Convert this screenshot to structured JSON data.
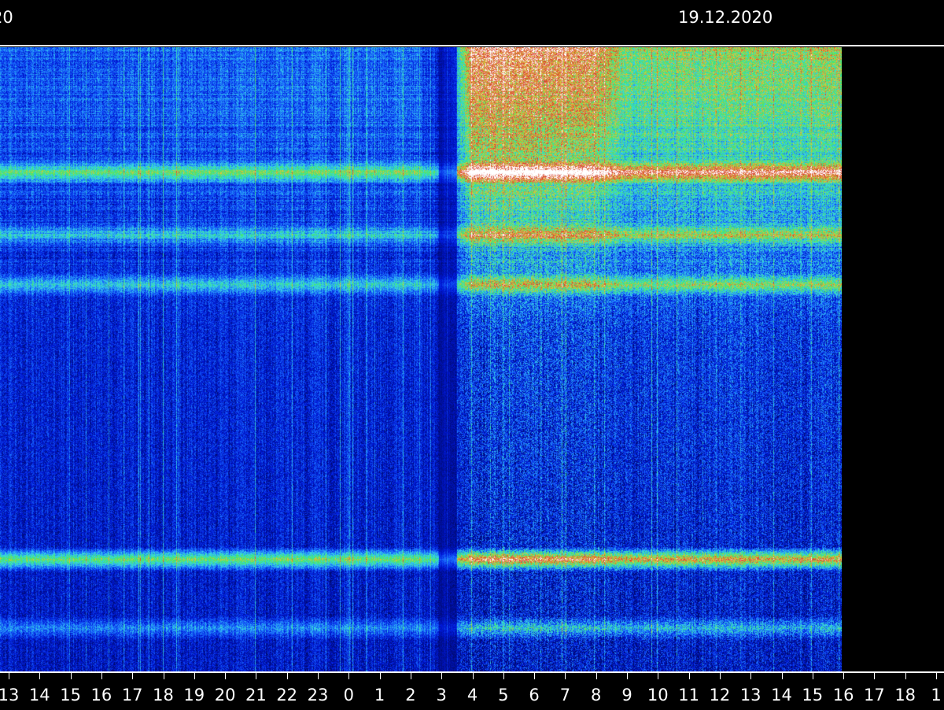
{
  "header": {
    "date_left": "20",
    "date_right": "19.12.2020"
  },
  "colors": {
    "background": "#000000",
    "axis": "#ffffff",
    "low_power": "#0a1fd6",
    "mid_power": "#2fe07a",
    "high_power": "#e0b030",
    "peak_power": "#ffffff"
  },
  "chart_data": {
    "type": "heatmap",
    "title": "",
    "xlabel": "",
    "ylabel": "",
    "x_tick_labels": [
      "13",
      "14",
      "15",
      "16",
      "17",
      "18",
      "19",
      "20",
      "21",
      "22",
      "23",
      "0",
      "1",
      "2",
      "3",
      "4",
      "5",
      "6",
      "7",
      "8",
      "9",
      "10",
      "11",
      "12",
      "13",
      "14",
      "15",
      "16",
      "17",
      "18",
      "1"
    ],
    "data_end_after_tick": "15",
    "colormap": [
      "#000a6e",
      "#0018d8",
      "#1a6cff",
      "#38d6e6",
      "#42e86a",
      "#e6c43a",
      "#d63c2c",
      "#ffffff"
    ],
    "bands": [
      {
        "y_frac": 0.2,
        "strength": 0.55
      },
      {
        "y_frac": 0.3,
        "strength": 0.35
      },
      {
        "y_frac": 0.38,
        "strength": 0.4
      },
      {
        "y_frac": 0.82,
        "strength": 0.7
      },
      {
        "y_frac": 0.93,
        "strength": 0.3
      }
    ],
    "activity_profile": [
      {
        "hour_index": 0,
        "level": 0.35
      },
      {
        "hour_index": 13,
        "level": 0.4
      },
      {
        "hour_index": 14,
        "level": 0.2
      },
      {
        "hour_index": 15,
        "level": 1.0
      },
      {
        "hour_index": 19,
        "level": 0.95
      },
      {
        "hour_index": 20,
        "level": 0.75
      },
      {
        "hour_index": 26,
        "level": 0.8
      }
    ]
  }
}
